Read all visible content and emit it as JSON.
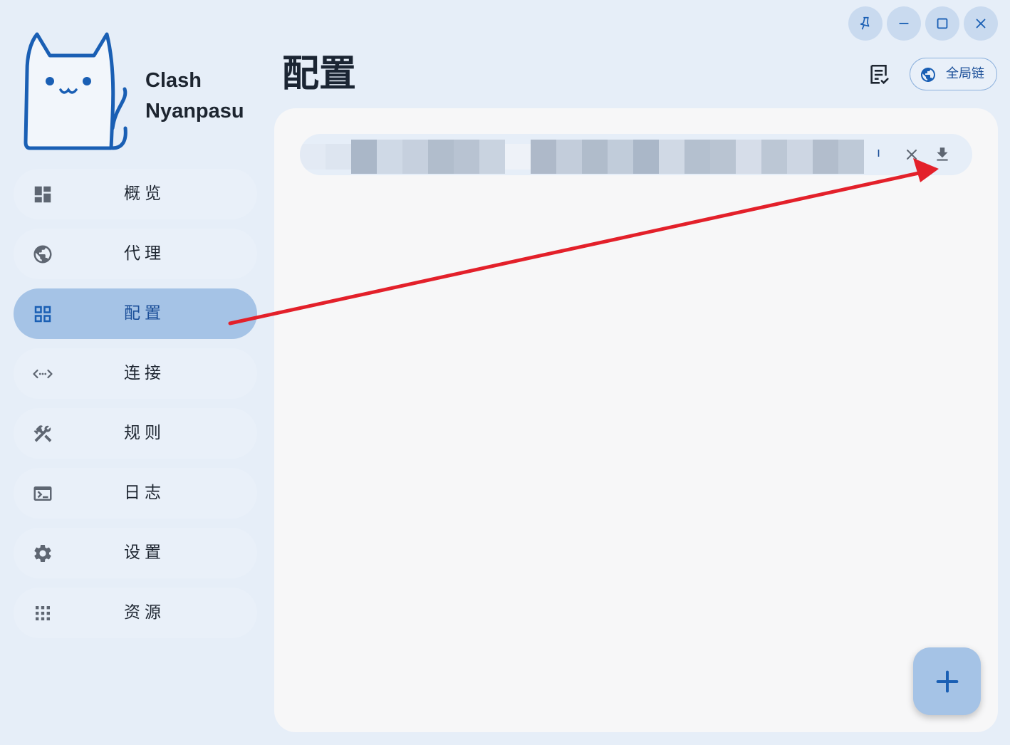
{
  "brand": {
    "line1": "Clash",
    "line2": "Nyanpasu"
  },
  "nav": {
    "items": [
      {
        "label": "概览",
        "icon": "dashboard-icon"
      },
      {
        "label": "代理",
        "icon": "globe-icon"
      },
      {
        "label": "配置",
        "icon": "grid-icon",
        "active": true
      },
      {
        "label": "连接",
        "icon": "connection-arrows-icon"
      },
      {
        "label": "规则",
        "icon": "tools-icon"
      },
      {
        "label": "日志",
        "icon": "terminal-icon"
      },
      {
        "label": "设置",
        "icon": "gear-icon"
      },
      {
        "label": "资源",
        "icon": "apps-grid-icon"
      }
    ]
  },
  "header": {
    "title": "配置",
    "chain_button": "全局链"
  },
  "profile": {
    "tail_char": "ı"
  },
  "colors": {
    "background": "#e6eef8",
    "panel": "#f7f7f8",
    "accent": "#1a4e98",
    "active_nav": "#a5c3e6",
    "annotation_arrow": "#e3202a"
  }
}
